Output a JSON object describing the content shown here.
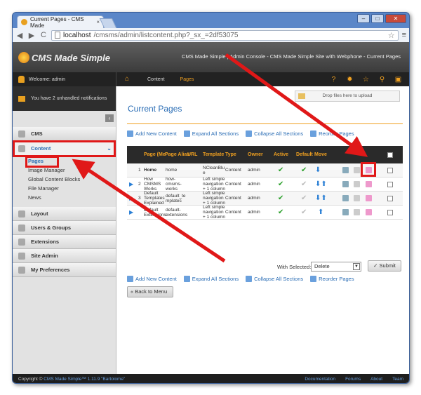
{
  "browser": {
    "tab_title": "Current Pages - CMS Made",
    "tab_close": "×",
    "url_host": "localhost",
    "url_rest": "/cmsms/admin/listcontent.php?_sx_=2df53075",
    "back": "◀",
    "forward": "▶",
    "reload": "C",
    "menu": "≡",
    "star": "☆",
    "min": "–",
    "max": "□",
    "close": "✕"
  },
  "header": {
    "logo": "CMS Made Simple",
    "title": "CMS Made Simple | Admin Console - CMS Made Simple Site with Webphone - Current Pages"
  },
  "navbar": {
    "welcome": "Welcome: admin",
    "tabs": [
      "Content",
      "Pages"
    ]
  },
  "sidebar": {
    "notification": "You have 2 unhandled notifications",
    "sections": [
      "CMS",
      "Content",
      "Layout",
      "Users & Groups",
      "Extensions",
      "Site Admin",
      "My Preferences"
    ],
    "content_items": [
      "Pages",
      "Image Manager",
      "Global Content Blocks",
      "File Manager",
      "News"
    ]
  },
  "main": {
    "title": "Current Pages",
    "dropzone": "Drop files here to upload",
    "actions": [
      "Add New Content",
      "Expand All Sections",
      "Collapse All Sections",
      "Reorder Pages"
    ],
    "columns": [
      "Page (Me",
      "Page Alias",
      "URL",
      "Template",
      "Type",
      "Owner",
      "Active",
      "Default",
      "Move"
    ],
    "rows": [
      {
        "num": "1",
        "title": "Home",
        "alias": "home",
        "template": "NCleanBlu e",
        "type": "Content",
        "owner": "admin"
      },
      {
        "num": "2",
        "title": "How CMSMS Works",
        "alias": "how-cmsms-works",
        "template": "Left simple navigation + 1 column",
        "type": "Content",
        "owner": "admin"
      },
      {
        "num": "3",
        "title": "Default Templates Explained",
        "alias": "default_te mplates",
        "template": "Left simple navigation + 1 column",
        "type": "Content",
        "owner": "admin"
      },
      {
        "num": "",
        "title": "Default Extensions",
        "alias": "default-extensions",
        "template": "Left simple navigation + 1 column",
        "type": "Content",
        "owner": "admin"
      }
    ],
    "with_selected": "With Selected:",
    "bulk_action": "Delete",
    "submit": "Submit",
    "back": "« Back to Menu"
  },
  "footer": {
    "copyright": "Copyright ©",
    "cms": "CMS Made Simple™ 1.11.9 \"Bartolome\"",
    "links": [
      "Documentation",
      "Forums",
      "About",
      "Team"
    ]
  }
}
